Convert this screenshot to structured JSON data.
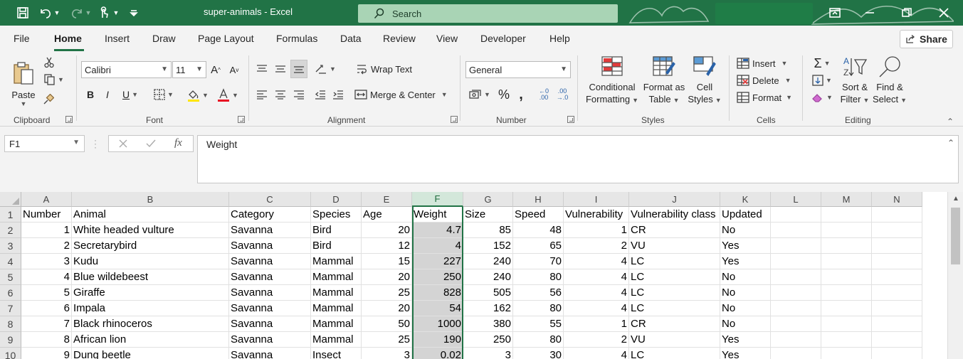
{
  "window": {
    "title": "super-animals  -  Excel",
    "search_placeholder": "Search"
  },
  "tabs": [
    "File",
    "Home",
    "Insert",
    "Draw",
    "Page Layout",
    "Formulas",
    "Data",
    "Review",
    "View",
    "Developer",
    "Help"
  ],
  "active_tab": "Home",
  "share_label": "Share",
  "ribbon": {
    "clipboard": {
      "label": "Clipboard",
      "paste": "Paste"
    },
    "font": {
      "label": "Font",
      "name": "Calibri",
      "size": "11"
    },
    "alignment": {
      "label": "Alignment",
      "wrap_text": "Wrap Text",
      "merge_center": "Merge & Center"
    },
    "number": {
      "label": "Number",
      "format": "General"
    },
    "styles": {
      "label": "Styles",
      "conditional_1": "Conditional",
      "conditional_2": "Formatting",
      "format_table_1": "Format as",
      "format_table_2": "Table",
      "cell_styles_1": "Cell",
      "cell_styles_2": "Styles"
    },
    "cells": {
      "label": "Cells",
      "insert": "Insert",
      "delete": "Delete",
      "format": "Format"
    },
    "editing": {
      "label": "Editing",
      "sort_1": "Sort &",
      "sort_2": "Filter",
      "find_1": "Find &",
      "find_2": "Select"
    }
  },
  "formula_bar": {
    "name_box": "F1",
    "fx": "fx",
    "content": "Weight"
  },
  "sheet": {
    "columns": [
      "A",
      "B",
      "C",
      "D",
      "E",
      "F",
      "G",
      "H",
      "I",
      "J",
      "K",
      "L",
      "M",
      "N"
    ],
    "selected_column": "F",
    "row_numbers": [
      "1",
      "2",
      "3",
      "4",
      "5",
      "6",
      "7",
      "8",
      "9",
      "10"
    ],
    "header": [
      "Number",
      "Animal",
      "Category",
      "Species",
      "Age",
      "Weight",
      "Size",
      "Speed",
      "Vulnerability",
      "Vulnerability class",
      "Updated"
    ],
    "rows": [
      [
        "1",
        "White headed vulture",
        "Savanna",
        "Bird",
        "20",
        "4.7",
        "85",
        "48",
        "1",
        "CR",
        "No"
      ],
      [
        "2",
        "Secretarybird",
        "Savanna",
        "Bird",
        "12",
        "4",
        "152",
        "65",
        "2",
        "VU",
        "Yes"
      ],
      [
        "3",
        "Kudu",
        "Savanna",
        "Mammal",
        "15",
        "227",
        "240",
        "70",
        "4",
        "LC",
        "Yes"
      ],
      [
        "4",
        "Blue wildebeest",
        "Savanna",
        "Mammal",
        "20",
        "250",
        "240",
        "80",
        "4",
        "LC",
        "No"
      ],
      [
        "5",
        "Giraffe",
        "Savanna",
        "Mammal",
        "25",
        "828",
        "505",
        "56",
        "4",
        "LC",
        "No"
      ],
      [
        "6",
        "Impala",
        "Savanna",
        "Mammal",
        "20",
        "54",
        "162",
        "80",
        "4",
        "LC",
        "No"
      ],
      [
        "7",
        "Black rhinoceros",
        "Savanna",
        "Mammal",
        "50",
        "1000",
        "380",
        "55",
        "1",
        "CR",
        "No"
      ],
      [
        "8",
        "African lion",
        "Savanna",
        "Mammal",
        "25",
        "190",
        "250",
        "80",
        "2",
        "VU",
        "Yes"
      ],
      [
        "9",
        "Dung beetle",
        "Savanna",
        "Insect",
        "3",
        "0.02",
        "3",
        "30",
        "4",
        "LC",
        "Yes"
      ]
    ]
  }
}
